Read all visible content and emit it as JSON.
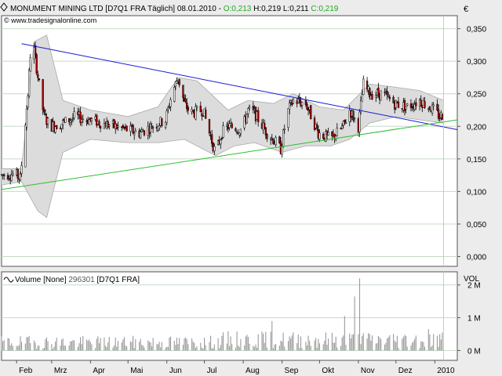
{
  "header": {
    "symbol_icon": "diamond-icon",
    "title_prefix": "MONUMENT MINING LTD [D7Q1 FRA  Täglich] 08.01.2010 - ",
    "open_value": "O:0,213",
    "hlc": " H:0,219 L:0,211 ",
    "close_value": "C:0,219",
    "copyright": "© www.tradesignalonline.com",
    "currency": "€"
  },
  "volume_panel": {
    "icon": "wave-icon",
    "label_prefix": "Volume [None] ",
    "value": "296301",
    "label_suffix": " [D7Q1 FRA]",
    "unit": "VOL"
  },
  "colors": {
    "panel_bg": "#ececec",
    "plot_bg": "#ffffff",
    "frame": "#555555",
    "grid": "#c7d9c7",
    "bollinger_fill": "#dcdcdc",
    "bollinger_line": "#a9a9a9",
    "candle_up": "#ffffff",
    "candle_down": "#b40000",
    "resistance_line": "#1a1ad6",
    "support_line": "#2fbf2f",
    "volume_bar": "#9a9a9a",
    "cursor_line": "#a8d8b8"
  },
  "chart_data": [
    {
      "type": "candlestick",
      "title": "MONUMENT MINING LTD [D7Q1 FRA  Täglich]",
      "ylabel": "€",
      "ylim": [
        -0.015,
        0.37
      ],
      "x_range": [
        "2010-01-20",
        "2011-01-19"
      ],
      "y_ticks": [
        "0,350",
        "0,300",
        "0,250",
        "0,200",
        "0,150",
        "0,100",
        "0,050",
        "0,000"
      ],
      "y_tick_values": [
        0.35,
        0.3,
        0.25,
        0.2,
        0.15,
        0.1,
        0.05,
        0.0
      ],
      "x_ticks": [
        "Feb",
        "Mrz",
        "Apr",
        "Mai",
        "Jun",
        "Jul",
        "Aug",
        "Sep",
        "Okt",
        "Nov",
        "Dez",
        "2010"
      ],
      "x_tick_dates": [
        "2010-02-01",
        "2010-03-01",
        "2010-04-01",
        "2010-05-01",
        "2010-06-01",
        "2010-07-01",
        "2010-08-01",
        "2010-09-01",
        "2010-10-01",
        "2010-11-01",
        "2010-12-01",
        "2011-01-01"
      ],
      "grid": true,
      "price_path": [
        [
          "2010-01-20",
          0.125
        ],
        [
          "2010-01-27",
          0.127
        ],
        [
          "2010-02-01",
          0.125
        ],
        [
          "2010-02-04",
          0.12
        ],
        [
          "2010-02-07",
          0.185
        ],
        [
          "2010-02-10",
          0.25
        ],
        [
          "2010-02-12",
          0.31
        ],
        [
          "2010-02-14",
          0.33
        ],
        [
          "2010-02-17",
          0.29
        ],
        [
          "2010-02-20",
          0.25
        ],
        [
          "2010-02-23",
          0.215
        ],
        [
          "2010-02-28",
          0.2
        ],
        [
          "2010-03-10",
          0.205
        ],
        [
          "2010-03-20",
          0.215
        ],
        [
          "2010-03-31",
          0.21
        ],
        [
          "2010-04-10",
          0.205
        ],
        [
          "2010-04-20",
          0.2
        ],
        [
          "2010-04-30",
          0.195
        ],
        [
          "2010-05-10",
          0.19
        ],
        [
          "2010-05-20",
          0.2
        ],
        [
          "2010-05-31",
          0.21
        ],
        [
          "2010-06-05",
          0.25
        ],
        [
          "2010-06-10",
          0.275
        ],
        [
          "2010-06-15",
          0.235
        ],
        [
          "2010-06-20",
          0.22
        ],
        [
          "2010-06-30",
          0.225
        ],
        [
          "2010-07-05",
          0.19
        ],
        [
          "2010-07-10",
          0.158
        ],
        [
          "2010-07-15",
          0.19
        ],
        [
          "2010-07-20",
          0.2
        ],
        [
          "2010-07-31",
          0.195
        ],
        [
          "2010-08-05",
          0.225
        ],
        [
          "2010-08-10",
          0.22
        ],
        [
          "2010-08-15",
          0.205
        ],
        [
          "2010-08-20",
          0.19
        ],
        [
          "2010-08-25",
          0.18
        ],
        [
          "2010-08-31",
          0.165
        ],
        [
          "2010-09-05",
          0.22
        ],
        [
          "2010-09-10",
          0.24
        ],
        [
          "2010-09-20",
          0.235
        ],
        [
          "2010-09-30",
          0.19
        ],
        [
          "2010-10-10",
          0.18
        ],
        [
          "2010-10-20",
          0.2
        ],
        [
          "2010-10-25",
          0.225
        ],
        [
          "2010-11-01",
          0.2
        ],
        [
          "2010-11-05",
          0.265
        ],
        [
          "2010-11-10",
          0.25
        ],
        [
          "2010-11-20",
          0.25
        ],
        [
          "2010-11-30",
          0.235
        ],
        [
          "2010-12-10",
          0.23
        ],
        [
          "2010-12-20",
          0.24
        ],
        [
          "2010-12-31",
          0.225
        ],
        [
          "2011-01-05",
          0.215
        ],
        [
          "2011-01-08",
          0.219
        ]
      ],
      "bollinger_upper": [
        [
          "2010-01-20",
          0.135
        ],
        [
          "2010-02-05",
          0.135
        ],
        [
          "2010-02-15",
          0.33
        ],
        [
          "2010-02-25",
          0.34
        ],
        [
          "2010-03-10",
          0.24
        ],
        [
          "2010-04-01",
          0.225
        ],
        [
          "2010-05-01",
          0.215
        ],
        [
          "2010-05-25",
          0.23
        ],
        [
          "2010-06-10",
          0.275
        ],
        [
          "2010-06-25",
          0.27
        ],
        [
          "2010-07-20",
          0.225
        ],
        [
          "2010-08-05",
          0.24
        ],
        [
          "2010-08-25",
          0.235
        ],
        [
          "2010-09-10",
          0.25
        ],
        [
          "2010-10-01",
          0.23
        ],
        [
          "2010-10-20",
          0.225
        ],
        [
          "2010-11-10",
          0.265
        ],
        [
          "2010-12-01",
          0.26
        ],
        [
          "2010-12-20",
          0.255
        ],
        [
          "2011-01-08",
          0.24
        ]
      ],
      "bollinger_lower": [
        [
          "2010-01-20",
          0.11
        ],
        [
          "2010-02-05",
          0.115
        ],
        [
          "2010-02-18",
          0.07
        ],
        [
          "2010-02-25",
          0.06
        ],
        [
          "2010-03-10",
          0.16
        ],
        [
          "2010-04-01",
          0.18
        ],
        [
          "2010-05-01",
          0.175
        ],
        [
          "2010-05-25",
          0.175
        ],
        [
          "2010-06-15",
          0.18
        ],
        [
          "2010-07-10",
          0.155
        ],
        [
          "2010-07-25",
          0.17
        ],
        [
          "2010-08-10",
          0.175
        ],
        [
          "2010-09-01",
          0.16
        ],
        [
          "2010-09-20",
          0.17
        ],
        [
          "2010-10-10",
          0.17
        ],
        [
          "2010-10-25",
          0.18
        ],
        [
          "2010-11-10",
          0.205
        ],
        [
          "2010-12-01",
          0.215
        ],
        [
          "2010-12-20",
          0.21
        ],
        [
          "2011-01-08",
          0.205
        ]
      ],
      "trendlines": [
        {
          "kind": "resistance",
          "from": [
            "2010-02-05",
            0.327
          ],
          "to": [
            "2011-01-19",
            0.195
          ]
        },
        {
          "kind": "support",
          "from": [
            "2010-01-20",
            0.103
          ],
          "to": [
            "2011-01-19",
            0.21
          ]
        }
      ],
      "cursor_date": "2011-01-08"
    },
    {
      "type": "bar",
      "title": "Volume [None] 296301 [D7Q1 FRA]",
      "ylabel": "VOL",
      "ylim": [
        -300000,
        2400000
      ],
      "y_ticks": [
        "2 M",
        "1 M",
        "0 M"
      ],
      "y_tick_values": [
        2000000,
        1000000,
        0
      ],
      "typical_volume": 250000,
      "spikes": [
        [
          "2010-11-02",
          2200000
        ],
        [
          "2010-10-29",
          1650000
        ],
        [
          "2010-10-21",
          1050000
        ],
        [
          "2010-08-24",
          900000
        ],
        [
          "2010-12-27",
          650000
        ],
        [
          "2011-01-08",
          296301
        ]
      ]
    }
  ]
}
